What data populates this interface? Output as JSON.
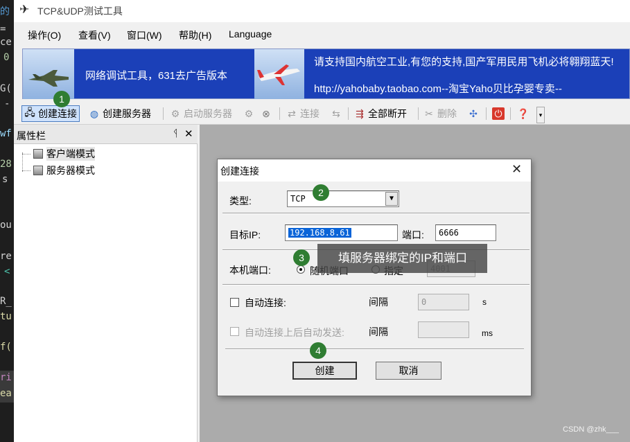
{
  "editor_strip": {
    "lines": [
      "的",
      "=",
      "ce",
      "0",
      "G(",
      "-",
      "wf",
      "28",
      "s",
      "ou",
      "re",
      "<",
      "R_",
      "tu",
      "f(",
      "ri",
      "ea"
    ]
  },
  "window": {
    "title": "TCP&UDP测试工具",
    "app_icon": "paper-plane-icon"
  },
  "menu": {
    "items": [
      "操作(O)",
      "查看(V)",
      "窗口(W)",
      "帮助(H)",
      "Language"
    ]
  },
  "banner": {
    "left_text": "网络调试工具，631去广告版本",
    "right_line1": "请支持国内航空工业,有您的支持,国产军用民用飞机必将翱翔蓝天!",
    "right_line2": "http://yahobaby.taobao.com--淘宝Yaho贝比孕婴专卖--"
  },
  "toolbar": {
    "create_connection": "创建连接",
    "create_server": "创建服务器",
    "start_server": "启动服务器",
    "connect": "连接",
    "disconnect_all": "全部断开",
    "delete": "删除"
  },
  "panel": {
    "title": "属性栏",
    "pin": "ᛩ",
    "close": "✕",
    "tree": [
      "客户端模式",
      "服务器模式"
    ]
  },
  "dialog": {
    "title": "创建连接",
    "close": "✕",
    "type_label": "类型:",
    "type_value": "TCP",
    "target_ip_label": "目标IP:",
    "target_ip_value": "192.168.8.61",
    "port_label": "端口:",
    "port_value": "6666",
    "local_port_label": "本机端口:",
    "random_port": "随机端口",
    "specify": "指定",
    "local_port_value": "4001",
    "auto_connect": "自动连接:",
    "interval_label": "间隔",
    "interval_value": "0",
    "interval_unit": "s",
    "auto_send": "自动连接上后自动发送:",
    "send_interval_label": "间隔",
    "send_interval_unit": "ms",
    "create_button": "创建",
    "cancel_button": "取消"
  },
  "annotations": {
    "badge1": "1",
    "badge2": "2",
    "badge3": "3",
    "badge4": "4",
    "tooltip": "填服务器绑定的IP和端口",
    "badge_color": "#2f7d32"
  },
  "watermark": "CSDN @zhk___"
}
